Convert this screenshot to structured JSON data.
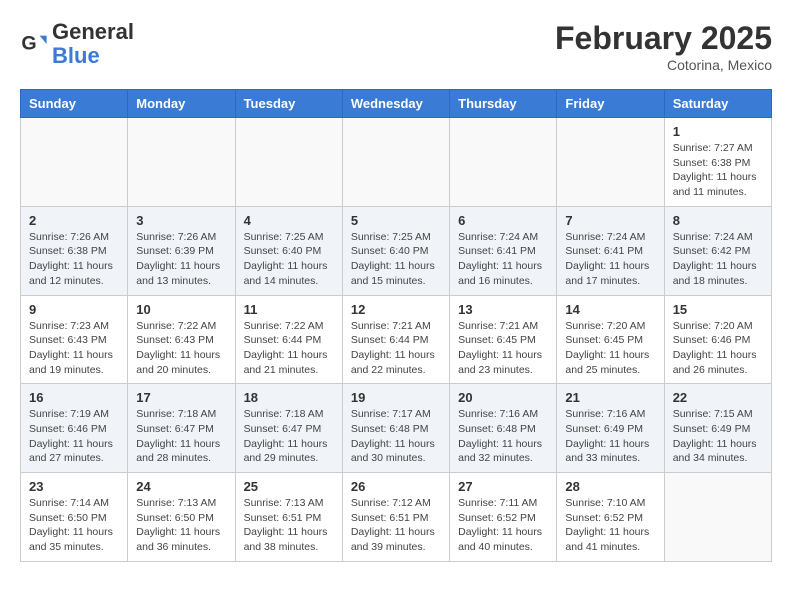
{
  "header": {
    "logo_general": "General",
    "logo_blue": "Blue",
    "month_title": "February 2025",
    "location": "Cotorina, Mexico"
  },
  "days_of_week": [
    "Sunday",
    "Monday",
    "Tuesday",
    "Wednesday",
    "Thursday",
    "Friday",
    "Saturday"
  ],
  "weeks": [
    {
      "shaded": false,
      "days": [
        {
          "number": "",
          "info": ""
        },
        {
          "number": "",
          "info": ""
        },
        {
          "number": "",
          "info": ""
        },
        {
          "number": "",
          "info": ""
        },
        {
          "number": "",
          "info": ""
        },
        {
          "number": "",
          "info": ""
        },
        {
          "number": "1",
          "info": "Sunrise: 7:27 AM\nSunset: 6:38 PM\nDaylight: 11 hours and 11 minutes."
        }
      ]
    },
    {
      "shaded": true,
      "days": [
        {
          "number": "2",
          "info": "Sunrise: 7:26 AM\nSunset: 6:38 PM\nDaylight: 11 hours and 12 minutes."
        },
        {
          "number": "3",
          "info": "Sunrise: 7:26 AM\nSunset: 6:39 PM\nDaylight: 11 hours and 13 minutes."
        },
        {
          "number": "4",
          "info": "Sunrise: 7:25 AM\nSunset: 6:40 PM\nDaylight: 11 hours and 14 minutes."
        },
        {
          "number": "5",
          "info": "Sunrise: 7:25 AM\nSunset: 6:40 PM\nDaylight: 11 hours and 15 minutes."
        },
        {
          "number": "6",
          "info": "Sunrise: 7:24 AM\nSunset: 6:41 PM\nDaylight: 11 hours and 16 minutes."
        },
        {
          "number": "7",
          "info": "Sunrise: 7:24 AM\nSunset: 6:41 PM\nDaylight: 11 hours and 17 minutes."
        },
        {
          "number": "8",
          "info": "Sunrise: 7:24 AM\nSunset: 6:42 PM\nDaylight: 11 hours and 18 minutes."
        }
      ]
    },
    {
      "shaded": false,
      "days": [
        {
          "number": "9",
          "info": "Sunrise: 7:23 AM\nSunset: 6:43 PM\nDaylight: 11 hours and 19 minutes."
        },
        {
          "number": "10",
          "info": "Sunrise: 7:22 AM\nSunset: 6:43 PM\nDaylight: 11 hours and 20 minutes."
        },
        {
          "number": "11",
          "info": "Sunrise: 7:22 AM\nSunset: 6:44 PM\nDaylight: 11 hours and 21 minutes."
        },
        {
          "number": "12",
          "info": "Sunrise: 7:21 AM\nSunset: 6:44 PM\nDaylight: 11 hours and 22 minutes."
        },
        {
          "number": "13",
          "info": "Sunrise: 7:21 AM\nSunset: 6:45 PM\nDaylight: 11 hours and 23 minutes."
        },
        {
          "number": "14",
          "info": "Sunrise: 7:20 AM\nSunset: 6:45 PM\nDaylight: 11 hours and 25 minutes."
        },
        {
          "number": "15",
          "info": "Sunrise: 7:20 AM\nSunset: 6:46 PM\nDaylight: 11 hours and 26 minutes."
        }
      ]
    },
    {
      "shaded": true,
      "days": [
        {
          "number": "16",
          "info": "Sunrise: 7:19 AM\nSunset: 6:46 PM\nDaylight: 11 hours and 27 minutes."
        },
        {
          "number": "17",
          "info": "Sunrise: 7:18 AM\nSunset: 6:47 PM\nDaylight: 11 hours and 28 minutes."
        },
        {
          "number": "18",
          "info": "Sunrise: 7:18 AM\nSunset: 6:47 PM\nDaylight: 11 hours and 29 minutes."
        },
        {
          "number": "19",
          "info": "Sunrise: 7:17 AM\nSunset: 6:48 PM\nDaylight: 11 hours and 30 minutes."
        },
        {
          "number": "20",
          "info": "Sunrise: 7:16 AM\nSunset: 6:48 PM\nDaylight: 11 hours and 32 minutes."
        },
        {
          "number": "21",
          "info": "Sunrise: 7:16 AM\nSunset: 6:49 PM\nDaylight: 11 hours and 33 minutes."
        },
        {
          "number": "22",
          "info": "Sunrise: 7:15 AM\nSunset: 6:49 PM\nDaylight: 11 hours and 34 minutes."
        }
      ]
    },
    {
      "shaded": false,
      "days": [
        {
          "number": "23",
          "info": "Sunrise: 7:14 AM\nSunset: 6:50 PM\nDaylight: 11 hours and 35 minutes."
        },
        {
          "number": "24",
          "info": "Sunrise: 7:13 AM\nSunset: 6:50 PM\nDaylight: 11 hours and 36 minutes."
        },
        {
          "number": "25",
          "info": "Sunrise: 7:13 AM\nSunset: 6:51 PM\nDaylight: 11 hours and 38 minutes."
        },
        {
          "number": "26",
          "info": "Sunrise: 7:12 AM\nSunset: 6:51 PM\nDaylight: 11 hours and 39 minutes."
        },
        {
          "number": "27",
          "info": "Sunrise: 7:11 AM\nSunset: 6:52 PM\nDaylight: 11 hours and 40 minutes."
        },
        {
          "number": "28",
          "info": "Sunrise: 7:10 AM\nSunset: 6:52 PM\nDaylight: 11 hours and 41 minutes."
        },
        {
          "number": "",
          "info": ""
        }
      ]
    }
  ]
}
